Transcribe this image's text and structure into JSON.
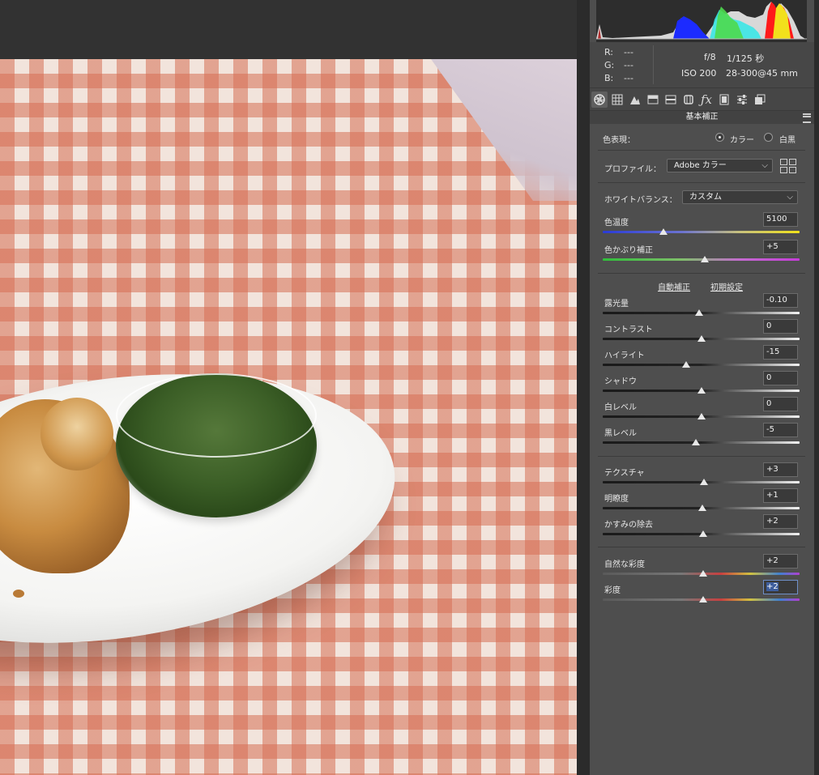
{
  "readout": {
    "r_label": "R:",
    "g_label": "G:",
    "b_label": "B:",
    "r_val": "---",
    "g_val": "---",
    "b_val": "---"
  },
  "exif": {
    "aperture": "f/8",
    "shutter": "1/125 秒",
    "iso": "ISO 200",
    "lens": "28-300@45 mm"
  },
  "tools": [
    "aperture-icon",
    "grid-curve-icon",
    "mountain-icon",
    "split-panel-icon",
    "hsl-icon",
    "lens-icon",
    "fx-icon",
    "film-icon",
    "sliders-icon",
    "presets-icon"
  ],
  "section_title": "基本補正",
  "treatment": {
    "label": "色表現：",
    "color_option": "カラー",
    "bw_option": "白黒",
    "selected": "color"
  },
  "profile": {
    "label": "プロファイル：",
    "value": "Adobe カラー"
  },
  "white_balance": {
    "label": "ホワイトバランス：",
    "value": "カスタム"
  },
  "links": {
    "auto": "自動補正",
    "default": "初期設定"
  },
  "sliders": {
    "temp": {
      "label": "色温度",
      "value": "5100",
      "level": 0.31
    },
    "tint": {
      "label": "色かぶり補正",
      "value": "+5",
      "level": 0.52
    },
    "exposure": {
      "label": "露光量",
      "value": "-0.10",
      "level": 0.49
    },
    "contrast": {
      "label": "コントラスト",
      "value": "0",
      "level": 0.5
    },
    "highlights": {
      "label": "ハイライト",
      "value": "-15",
      "level": 0.425
    },
    "shadows": {
      "label": "シャドウ",
      "value": "0",
      "level": 0.5
    },
    "whites": {
      "label": "白レベル",
      "value": "0",
      "level": 0.5
    },
    "blacks": {
      "label": "黒レベル",
      "value": "-5",
      "level": 0.475
    },
    "texture": {
      "label": "テクスチャ",
      "value": "+3",
      "level": 0.515
    },
    "clarity": {
      "label": "明瞭度",
      "value": "+1",
      "level": 0.505
    },
    "dehaze": {
      "label": "かすみの除去",
      "value": "+2",
      "level": 0.51
    },
    "vibrance": {
      "label": "自然な彩度",
      "value": "+2",
      "level": 0.51
    },
    "saturation": {
      "label": "彩度",
      "value": "+2",
      "level": 0.51
    }
  },
  "colors": {
    "panel_bg": "#4e4e4e",
    "selection": "#3d5d9c"
  }
}
